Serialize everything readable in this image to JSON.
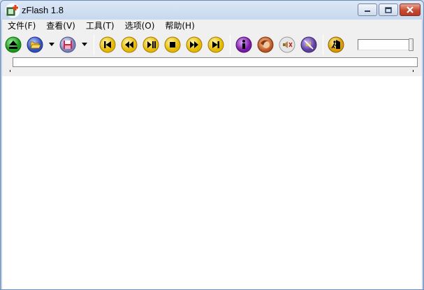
{
  "window": {
    "title": "zFlash 1.8",
    "icon": "zflash-app-icon"
  },
  "window_buttons": {
    "minimize": "minimize-icon",
    "maximize": "maximize-icon",
    "close": "close-icon"
  },
  "menu": [
    {
      "label": "文件(F)"
    },
    {
      "label": "查看(V)"
    },
    {
      "label": "工具(T)"
    },
    {
      "label": "选项(O)"
    },
    {
      "label": "帮助(H)"
    }
  ],
  "toolbar": {
    "buttons": [
      {
        "name": "eject-icon",
        "color": "#2db82d"
      },
      {
        "name": "open-folder-icon",
        "color": "#4b6fd8"
      },
      {
        "name": "save-disk-icon",
        "color": "#8a8fbf"
      },
      {
        "name": "skip-to-start-icon",
        "color": "#f2d21a"
      },
      {
        "name": "rewind-icon",
        "color": "#f2d21a"
      },
      {
        "name": "play-pause-icon",
        "color": "#f2d21a"
      },
      {
        "name": "stop-icon",
        "color": "#f2d21a"
      },
      {
        "name": "fast-forward-icon",
        "color": "#f2d21a"
      },
      {
        "name": "skip-to-end-icon",
        "color": "#f2d21a"
      },
      {
        "name": "info-icon",
        "color": "#9b2bd1"
      },
      {
        "name": "face-icon",
        "color": "#d47a3b"
      },
      {
        "name": "mute-speaker-icon",
        "color": "#d0d0d0"
      },
      {
        "name": "no-sound-icon",
        "color": "#7a5fa8"
      },
      {
        "name": "exit-runner-icon",
        "color": "#f2c11a"
      }
    ],
    "volume_level": 1.0
  }
}
